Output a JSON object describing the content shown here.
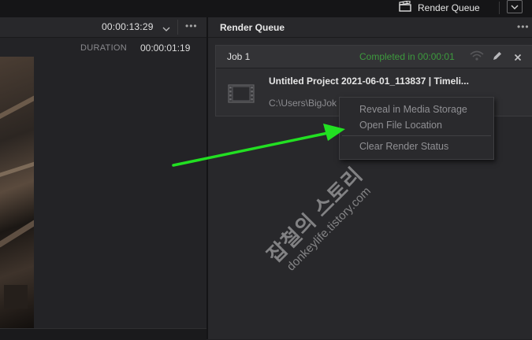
{
  "topbar": {
    "render_queue_label": "Render Queue",
    "icons": [
      "clapperboard-icon",
      "chevron-down-icon"
    ]
  },
  "viewer_header": {
    "timecode": "00:00:13:29",
    "duration_label": "DURATION",
    "duration_value": "00:00:01:19",
    "options_label": "•••"
  },
  "render_queue": {
    "title": "Render Queue",
    "options_label": "•••",
    "job": {
      "title": "Job 1",
      "status": "Completed in 00:00:01",
      "status_color": "#3d9a3d",
      "filename": "Untitled Project 2021-06-01_113837 | Timeli...",
      "path": "C:\\Users\\BigJok",
      "icons": [
        "wireless-icon",
        "pencil-icon",
        "close-icon",
        "film-thumbnail-icon"
      ]
    }
  },
  "context_menu": {
    "items": [
      "Reveal in Media Storage",
      "Open File Location",
      "Clear Render Status"
    ]
  },
  "annotation": {
    "arrow_color": "#22e022"
  },
  "watermark": {
    "line1": "잡철의 스토리",
    "line2": "donkeylife.tistory.com"
  }
}
